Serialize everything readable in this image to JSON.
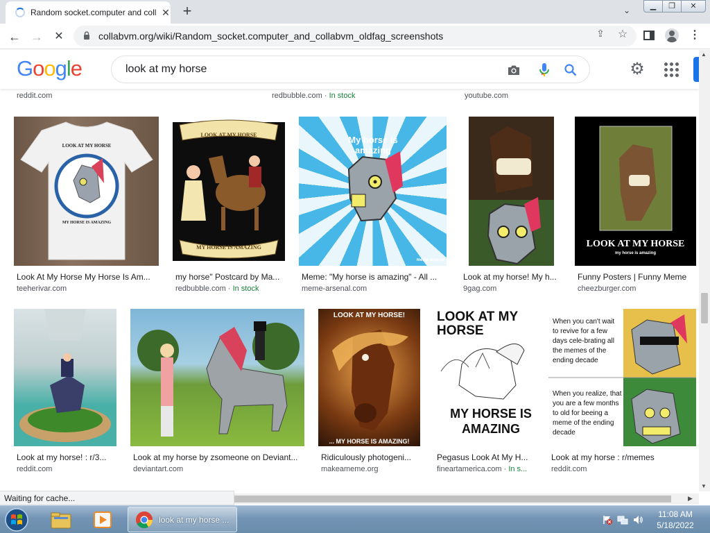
{
  "browser": {
    "tab_title": "Random socket.computer and collabvm_oldfag_screenshots",
    "url": "collabvm.org/wiki/Random_socket.computer_and_collabvm_oldfag_screenshots",
    "status_text": "Waiting for cache..."
  },
  "google": {
    "logo_letters": [
      "G",
      "o",
      "o",
      "g",
      "l",
      "e"
    ],
    "logo_colors": [
      "#4285f4",
      "#ea4335",
      "#fbbc05",
      "#4285f4",
      "#34a853",
      "#ea4335"
    ],
    "query": "look at my horse"
  },
  "top_sources": [
    {
      "site": "reddit.com",
      "stock": ""
    },
    {
      "site": "redbubble.com",
      "stock": "In stock"
    },
    {
      "site": "youtube.com",
      "stock": ""
    }
  ],
  "row1": [
    {
      "title": "Look At My Horse My Horse Is Am...",
      "site": "teeherivar.com",
      "stock": "",
      "overlay_top": "LOOK AT MY HORSE",
      "overlay_bottom": "MY HORSE IS AMAZING"
    },
    {
      "title": "my horse\" Postcard by Ma...",
      "site": "redbubble.com",
      "stock": "In stock",
      "overlay_top": "LOOK AT MY HORSE",
      "overlay_bottom": "MY HORSE IS AMAZING"
    },
    {
      "title": "Meme: \"My horse is amazing\" - All ...",
      "site": "meme-arsenal.com",
      "stock": "",
      "overlay_top": "My horse is amazing",
      "overlay_bottom": "meme-arsenal"
    },
    {
      "title": "Look at my horse! My h...",
      "site": "9gag.com",
      "stock": "",
      "overlay_top": "",
      "overlay_bottom": ""
    },
    {
      "title": "Funny Posters | Funny Meme",
      "site": "cheezburger.com",
      "stock": "",
      "overlay_top": "LOOK AT MY HORSE",
      "overlay_bottom": "my horse is amazing"
    }
  ],
  "row2": [
    {
      "title": "Look at my horse! : r/3...",
      "site": "reddit.com",
      "stock": "",
      "overlay_top": "",
      "overlay_bottom": ""
    },
    {
      "title": "Look at my horse by zsomeone on Deviant...",
      "site": "deviantart.com",
      "stock": "",
      "overlay_top": "",
      "overlay_bottom": ""
    },
    {
      "title": "Ridiculously photogeni...",
      "site": "makeameme.org",
      "stock": "",
      "overlay_top": "LOOK AT MY HORSE!",
      "overlay_bottom": "... MY HORSE IS AMAZING!"
    },
    {
      "title": "Pegasus Look At My H...",
      "site": "fineartamerica.com",
      "stock": "In s...",
      "overlay_top": "LOOK AT MY HORSE",
      "overlay_bottom": "MY HORSE IS AMAZING"
    },
    {
      "title": "Look at my horse : r/memes",
      "site": "reddit.com",
      "stock": "",
      "overlay_top": "When you can't wait to revive for a few days cele-brating all the memes of the ending decade",
      "overlay_bottom": "When you realize, that you are a few months to old for beeing a meme of the ending decade"
    }
  ],
  "taskbar": {
    "chrome_label": "look at my horse ...",
    "time": "11:08 AM",
    "date": "5/18/2022"
  }
}
